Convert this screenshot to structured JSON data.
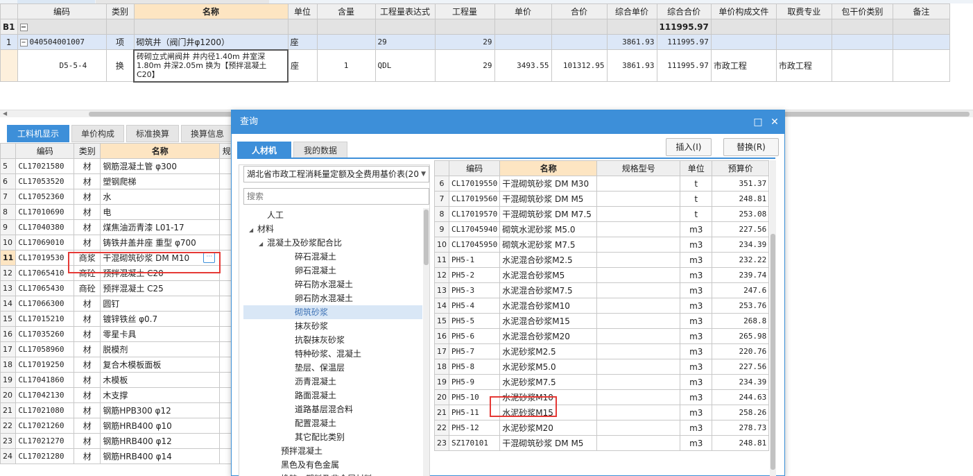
{
  "top_table": {
    "headers": [
      "编码",
      "类别",
      "名称",
      "单位",
      "含量",
      "工程量表达式",
      "工程量",
      "单价",
      "合价",
      "综合单价",
      "综合合价",
      "单价构成文件",
      "取费专业",
      "包干价类别",
      "备注"
    ],
    "group_row": {
      "label": "B1",
      "total": "111995.97"
    },
    "rows": [
      {
        "no": "1",
        "code": "040504001007",
        "type": "项",
        "name": "砌筑井（阀门井φ1200）",
        "unit": "座",
        "content": "",
        "expr": "29",
        "qty": "29",
        "price": "",
        "amount": "",
        "unit_total": "3861.93",
        "total": "111995.97",
        "file": "",
        "spec": ""
      },
      {
        "no": "",
        "code": "D5-5-4",
        "type": "换",
        "name": "砖砌立式闸阀井 井内径1.40m 井室深1.80m 井深2.05m  换为【预拌混凝土 C20】",
        "unit": "座",
        "content": "1",
        "expr": "QDL",
        "qty": "29",
        "price": "3493.55",
        "amount": "101312.95",
        "unit_total": "3861.93",
        "total": "111995.97",
        "file": "市政工程",
        "spec": "市政工程"
      }
    ]
  },
  "bottom_tabs": [
    "工料机显示",
    "单价构成",
    "标准换算",
    "换算信息"
  ],
  "material_table": {
    "headers": [
      "编码",
      "类别",
      "名称",
      "规"
    ],
    "rows": [
      {
        "no": "5",
        "code": "CL17021580",
        "type": "材",
        "name": "钢筋混凝土管 φ300"
      },
      {
        "no": "6",
        "code": "CL17053520",
        "type": "材",
        "name": "塑钢爬梯"
      },
      {
        "no": "7",
        "code": "CL17052360",
        "type": "材",
        "name": "水"
      },
      {
        "no": "8",
        "code": "CL17010690",
        "type": "材",
        "name": "电"
      },
      {
        "no": "9",
        "code": "CL17040380",
        "type": "材",
        "name": "煤焦油沥青漆 L01-17"
      },
      {
        "no": "10",
        "code": "CL17069010",
        "type": "材",
        "name": "铸铁井盖井座 重型 φ700"
      },
      {
        "no": "11",
        "code": "CL17019530",
        "type": "商浆",
        "name": "干混砌筑砂浆 DM M10"
      },
      {
        "no": "12",
        "code": "CL17065410",
        "type": "商砼",
        "name": "预拌混凝土 C20"
      },
      {
        "no": "13",
        "code": "CL17065430",
        "type": "商砼",
        "name": "预拌混凝土 C25"
      },
      {
        "no": "14",
        "code": "CL17066300",
        "type": "材",
        "name": "圆钉"
      },
      {
        "no": "15",
        "code": "CL17015210",
        "type": "材",
        "name": "镀锌铁丝 φ0.7"
      },
      {
        "no": "16",
        "code": "CL17035260",
        "type": "材",
        "name": "零星卡具"
      },
      {
        "no": "17",
        "code": "CL17058960",
        "type": "材",
        "name": "脱模剂"
      },
      {
        "no": "18",
        "code": "CL17019250",
        "type": "材",
        "name": "复合木模板面板"
      },
      {
        "no": "19",
        "code": "CL17041860",
        "type": "材",
        "name": "木模板"
      },
      {
        "no": "20",
        "code": "CL17042130",
        "type": "材",
        "name": "木支撑"
      },
      {
        "no": "21",
        "code": "CL17021080",
        "type": "材",
        "name": "钢筋HPB300 φ12"
      },
      {
        "no": "22",
        "code": "CL17021260",
        "type": "材",
        "name": "钢筋HRB400 φ10"
      },
      {
        "no": "23",
        "code": "CL17021270",
        "type": "材",
        "name": "钢筋HRB400 φ12"
      },
      {
        "no": "24",
        "code": "CL17021280",
        "type": "材",
        "name": "钢筋HRB400 φ14"
      }
    ]
  },
  "dialog": {
    "title": "查询",
    "tabs": [
      "人材机",
      "我的数据"
    ],
    "insert_label": "插入(I)",
    "replace_label": "替换(R)",
    "quota_select": "湖北省市政工程消耗量定额及全费用基价表(20",
    "search_placeholder": "搜索",
    "tree": [
      {
        "label": "人工",
        "level": 1,
        "arrow": ""
      },
      {
        "label": "材料",
        "level": 0,
        "arrow": "◢"
      },
      {
        "label": "混凝土及砂浆配合比",
        "level": 1,
        "arrow": "◢"
      },
      {
        "label": "碎石混凝土",
        "level": 3,
        "arrow": ""
      },
      {
        "label": "卵石混凝土",
        "level": 3,
        "arrow": ""
      },
      {
        "label": "碎石防水混凝土",
        "level": 3,
        "arrow": ""
      },
      {
        "label": "卵石防水混凝土",
        "level": 3,
        "arrow": ""
      },
      {
        "label": "砌筑砂浆",
        "level": 3,
        "arrow": "",
        "selected": true
      },
      {
        "label": "抹灰砂浆",
        "level": 3,
        "arrow": ""
      },
      {
        "label": "抗裂抹灰砂浆",
        "level": 3,
        "arrow": ""
      },
      {
        "label": "特种砂浆、混凝土",
        "level": 3,
        "arrow": ""
      },
      {
        "label": "垫层、保温层",
        "level": 3,
        "arrow": ""
      },
      {
        "label": "沥青混凝土",
        "level": 3,
        "arrow": ""
      },
      {
        "label": "路面混凝土",
        "level": 3,
        "arrow": ""
      },
      {
        "label": "道路基层混合料",
        "level": 3,
        "arrow": ""
      },
      {
        "label": "配置混凝土",
        "level": 3,
        "arrow": ""
      },
      {
        "label": "其它配比类别",
        "level": 3,
        "arrow": ""
      },
      {
        "label": "预拌混凝土",
        "level": 2,
        "arrow": ""
      },
      {
        "label": "黑色及有色金属",
        "level": 2,
        "arrow": ""
      },
      {
        "label": "橡胶、塑料及非金属材料",
        "level": 2,
        "arrow": ""
      }
    ],
    "result_headers": [
      "编码",
      "名称",
      "规格型号",
      "单位",
      "预算价"
    ],
    "results": [
      {
        "no": "6",
        "code": "CL17019550",
        "name": "干混砌筑砂浆 DM M30",
        "spec": "",
        "unit": "t",
        "price": "351.37"
      },
      {
        "no": "7",
        "code": "CL17019560",
        "name": "干混砌筑砂浆 DM M5",
        "spec": "",
        "unit": "t",
        "price": "248.81"
      },
      {
        "no": "8",
        "code": "CL17019570",
        "name": "干混砌筑砂浆 DM M7.5",
        "spec": "",
        "unit": "t",
        "price": "253.08"
      },
      {
        "no": "9",
        "code": "CL17045940",
        "name": "砌筑水泥砂浆 M5.0",
        "spec": "",
        "unit": "m3",
        "price": "227.56"
      },
      {
        "no": "10",
        "code": "CL17045950",
        "name": "砌筑水泥砂浆 M7.5",
        "spec": "",
        "unit": "m3",
        "price": "234.39"
      },
      {
        "no": "11",
        "code": "PH5-1",
        "name": "水泥混合砂浆M2.5",
        "spec": "",
        "unit": "m3",
        "price": "232.22"
      },
      {
        "no": "12",
        "code": "PH5-2",
        "name": "水泥混合砂浆M5",
        "spec": "",
        "unit": "m3",
        "price": "239.74"
      },
      {
        "no": "13",
        "code": "PH5-3",
        "name": "水泥混合砂浆M7.5",
        "spec": "",
        "unit": "m3",
        "price": "247.6"
      },
      {
        "no": "14",
        "code": "PH5-4",
        "name": "水泥混合砂浆M10",
        "spec": "",
        "unit": "m3",
        "price": "253.76"
      },
      {
        "no": "15",
        "code": "PH5-5",
        "name": "水泥混合砂浆M15",
        "spec": "",
        "unit": "m3",
        "price": "268.8"
      },
      {
        "no": "16",
        "code": "PH5-6",
        "name": "水泥混合砂浆M20",
        "spec": "",
        "unit": "m3",
        "price": "265.98"
      },
      {
        "no": "17",
        "code": "PH5-7",
        "name": "水泥砂浆M2.5",
        "spec": "",
        "unit": "m3",
        "price": "220.76"
      },
      {
        "no": "18",
        "code": "PH5-8",
        "name": "水泥砂浆M5.0",
        "spec": "",
        "unit": "m3",
        "price": "227.56"
      },
      {
        "no": "19",
        "code": "PH5-9",
        "name": "水泥砂浆M7.5",
        "spec": "",
        "unit": "m3",
        "price": "234.39"
      },
      {
        "no": "20",
        "code": "PH5-10",
        "name": "水泥砂浆M10",
        "spec": "",
        "unit": "m3",
        "price": "244.63"
      },
      {
        "no": "21",
        "code": "PH5-11",
        "name": "水泥砂浆M15",
        "spec": "",
        "unit": "m3",
        "price": "258.26"
      },
      {
        "no": "22",
        "code": "PH5-12",
        "name": "水泥砂浆M20",
        "spec": "",
        "unit": "m3",
        "price": "278.73"
      },
      {
        "no": "23",
        "code": "SZ170101",
        "name": "干混砌筑砂浆 DM M5",
        "spec": "",
        "unit": "m3",
        "price": "248.81"
      }
    ]
  },
  "colors": {
    "accent": "#3d8fd9",
    "highlight": "#e53935",
    "header_active": "#fde5c2"
  },
  "icons": {
    "collapse": "minus-square-icon",
    "maximize": "maximize-icon",
    "close": "close-icon",
    "ellipsis": "ellipsis-icon"
  }
}
